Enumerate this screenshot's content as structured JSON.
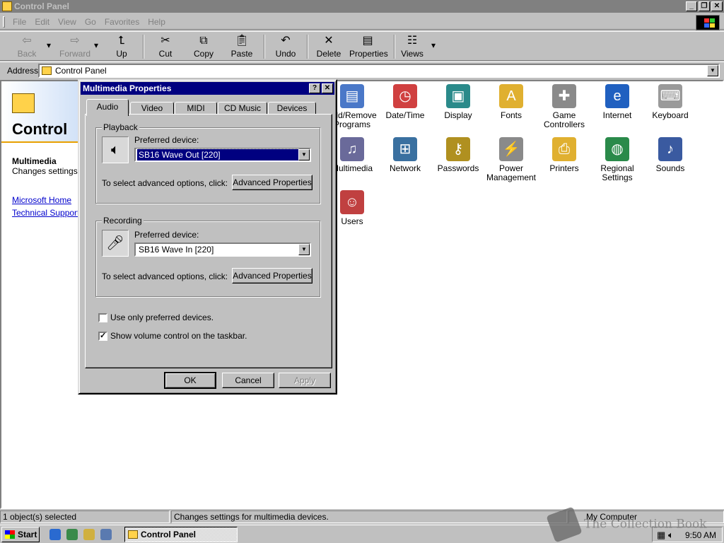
{
  "window": {
    "title": "Control Panel"
  },
  "menu": [
    "File",
    "Edit",
    "View",
    "Go",
    "Favorites",
    "Help"
  ],
  "toolbar": [
    {
      "label": "Back",
      "icon": "back-arrow-icon",
      "enabled": false
    },
    {
      "label": "Forward",
      "icon": "forward-arrow-icon",
      "enabled": false
    },
    {
      "label": "Up",
      "icon": "up-folder-icon",
      "enabled": true
    },
    {
      "label": "Cut",
      "icon": "scissors-icon",
      "enabled": true
    },
    {
      "label": "Copy",
      "icon": "copy-icon",
      "enabled": true
    },
    {
      "label": "Paste",
      "icon": "paste-icon",
      "enabled": true
    },
    {
      "label": "Undo",
      "icon": "undo-icon",
      "enabled": true
    },
    {
      "label": "Delete",
      "icon": "delete-icon",
      "enabled": true
    },
    {
      "label": "Properties",
      "icon": "properties-icon",
      "enabled": true
    },
    {
      "label": "Views",
      "icon": "views-icon",
      "enabled": true
    }
  ],
  "address": {
    "label": "Address",
    "value": "Control Panel"
  },
  "webview": {
    "title": "Control",
    "selected_name": "Multimedia",
    "selected_desc": "Changes settings for multimedia devices.",
    "links": [
      "Microsoft Home",
      "Technical Support"
    ]
  },
  "icons": [
    {
      "label": "Add/Remove Programs",
      "glyph": "▤",
      "color": "#4a78c8"
    },
    {
      "label": "Date/Time",
      "glyph": "◷",
      "color": "#d04040"
    },
    {
      "label": "Display",
      "glyph": "▣",
      "color": "#2a8a8a"
    },
    {
      "label": "Fonts",
      "glyph": "A",
      "color": "#e0b030"
    },
    {
      "label": "Game Controllers",
      "glyph": "✚",
      "color": "#8a8a8a"
    },
    {
      "label": "Internet",
      "glyph": "e",
      "color": "#2060c0"
    },
    {
      "label": "Keyboard",
      "glyph": "⌨",
      "color": "#9a9a9a"
    },
    {
      "label": "Multimedia",
      "glyph": "♫",
      "color": "#6a6a9a"
    },
    {
      "label": "Network",
      "glyph": "⊞",
      "color": "#3a70a0"
    },
    {
      "label": "Passwords",
      "glyph": "⚷",
      "color": "#b09020"
    },
    {
      "label": "Power Management",
      "glyph": "⚡",
      "color": "#8a8a8a"
    },
    {
      "label": "Printers",
      "glyph": "⎙",
      "color": "#e0b030"
    },
    {
      "label": "Regional Settings",
      "glyph": "◍",
      "color": "#2a8a4a"
    },
    {
      "label": "Sounds",
      "glyph": "♪",
      "color": "#3a5aa0"
    },
    {
      "label": "Users",
      "glyph": "☺",
      "color": "#c04040"
    }
  ],
  "status": {
    "objects": "1 object(s) selected",
    "description": "Changes settings for multimedia devices.",
    "zone": "My Computer"
  },
  "taskbar": {
    "start": "Start",
    "task": "Control Panel",
    "clock": "9:50 AM"
  },
  "watermark": "The Collection Book",
  "dialog": {
    "title": "Multimedia Properties",
    "tabs": [
      "Audio",
      "Video",
      "MIDI",
      "CD Music",
      "Devices"
    ],
    "active_tab": "Audio",
    "playback": {
      "group": "Playback",
      "pref_label": "Preferred device:",
      "device": "SB16 Wave Out [220]",
      "adv_text": "To select advanced options, click:",
      "adv_button": "Advanced Properties"
    },
    "recording": {
      "group": "Recording",
      "pref_label": "Preferred device:",
      "device": "SB16 Wave In [220]",
      "adv_text": "To select advanced options, click:",
      "adv_button": "Advanced Properties"
    },
    "options": [
      {
        "label": "Use only preferred devices.",
        "checked": false
      },
      {
        "label": "Show volume control on the taskbar.",
        "checked": true
      }
    ],
    "buttons": {
      "ok": "OK",
      "cancel": "Cancel",
      "apply": "Apply"
    }
  }
}
